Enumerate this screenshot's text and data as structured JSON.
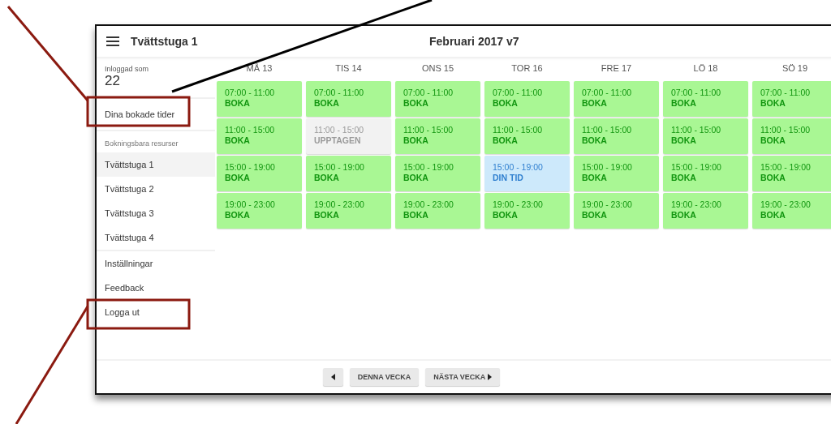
{
  "window": {
    "title": "Tvättstuga 1",
    "period": "Februari 2017 v7"
  },
  "sidebar": {
    "logged_in_label": "Inloggad som",
    "user": "22",
    "booked_link": "Dina bokade tider",
    "resources_heading": "Bokningsbara resurser",
    "resources": [
      {
        "label": "Tvättstuga 1",
        "selected": true
      },
      {
        "label": "Tvättstuga 2",
        "selected": false
      },
      {
        "label": "Tvättstuga 3",
        "selected": false
      },
      {
        "label": "Tvättstuga 4",
        "selected": false
      }
    ],
    "links": [
      "Inställningar",
      "Feedback",
      "Logga ut"
    ]
  },
  "days": [
    {
      "label": "MÅ 13",
      "slots": [
        {
          "time": "07:00 - 11:00",
          "status": "BOKA",
          "kind": "free"
        },
        {
          "time": "11:00 - 15:00",
          "status": "BOKA",
          "kind": "free"
        },
        {
          "time": "15:00 - 19:00",
          "status": "BOKA",
          "kind": "free"
        },
        {
          "time": "19:00 - 23:00",
          "status": "BOKA",
          "kind": "free"
        }
      ]
    },
    {
      "label": "TIS 14",
      "slots": [
        {
          "time": "07:00 - 11:00",
          "status": "BOKA",
          "kind": "free"
        },
        {
          "time": "11:00 - 15:00",
          "status": "UPPTAGEN",
          "kind": "taken"
        },
        {
          "time": "15:00 - 19:00",
          "status": "BOKA",
          "kind": "free"
        },
        {
          "time": "19:00 - 23:00",
          "status": "BOKA",
          "kind": "free"
        }
      ]
    },
    {
      "label": "ONS 15",
      "slots": [
        {
          "time": "07:00 - 11:00",
          "status": "BOKA",
          "kind": "free"
        },
        {
          "time": "11:00 - 15:00",
          "status": "BOKA",
          "kind": "free"
        },
        {
          "time": "15:00 - 19:00",
          "status": "BOKA",
          "kind": "free"
        },
        {
          "time": "19:00 - 23:00",
          "status": "BOKA",
          "kind": "free"
        }
      ]
    },
    {
      "label": "TOR 16",
      "slots": [
        {
          "time": "07:00 - 11:00",
          "status": "BOKA",
          "kind": "free"
        },
        {
          "time": "11:00 - 15:00",
          "status": "BOKA",
          "kind": "free"
        },
        {
          "time": "15:00 - 19:00",
          "status": "DIN TID",
          "kind": "mine"
        },
        {
          "time": "19:00 - 23:00",
          "status": "BOKA",
          "kind": "free"
        }
      ]
    },
    {
      "label": "FRE 17",
      "slots": [
        {
          "time": "07:00 - 11:00",
          "status": "BOKA",
          "kind": "free"
        },
        {
          "time": "11:00 - 15:00",
          "status": "BOKA",
          "kind": "free"
        },
        {
          "time": "15:00 - 19:00",
          "status": "BOKA",
          "kind": "free"
        },
        {
          "time": "19:00 - 23:00",
          "status": "BOKA",
          "kind": "free"
        }
      ]
    },
    {
      "label": "LÖ 18",
      "slots": [
        {
          "time": "07:00 - 11:00",
          "status": "BOKA",
          "kind": "free"
        },
        {
          "time": "11:00 - 15:00",
          "status": "BOKA",
          "kind": "free"
        },
        {
          "time": "15:00 - 19:00",
          "status": "BOKA",
          "kind": "free"
        },
        {
          "time": "19:00 - 23:00",
          "status": "BOKA",
          "kind": "free"
        }
      ]
    },
    {
      "label": "SÖ 19",
      "slots": [
        {
          "time": "07:00 - 11:00",
          "status": "BOKA",
          "kind": "free"
        },
        {
          "time": "11:00 - 15:00",
          "status": "BOKA",
          "kind": "free"
        },
        {
          "time": "15:00 - 19:00",
          "status": "BOKA",
          "kind": "free"
        },
        {
          "time": "19:00 - 23:00",
          "status": "BOKA",
          "kind": "free"
        }
      ]
    }
  ],
  "footer": {
    "this_week": "DENNA VECKA",
    "next_week": "NÄSTA VECKA"
  }
}
